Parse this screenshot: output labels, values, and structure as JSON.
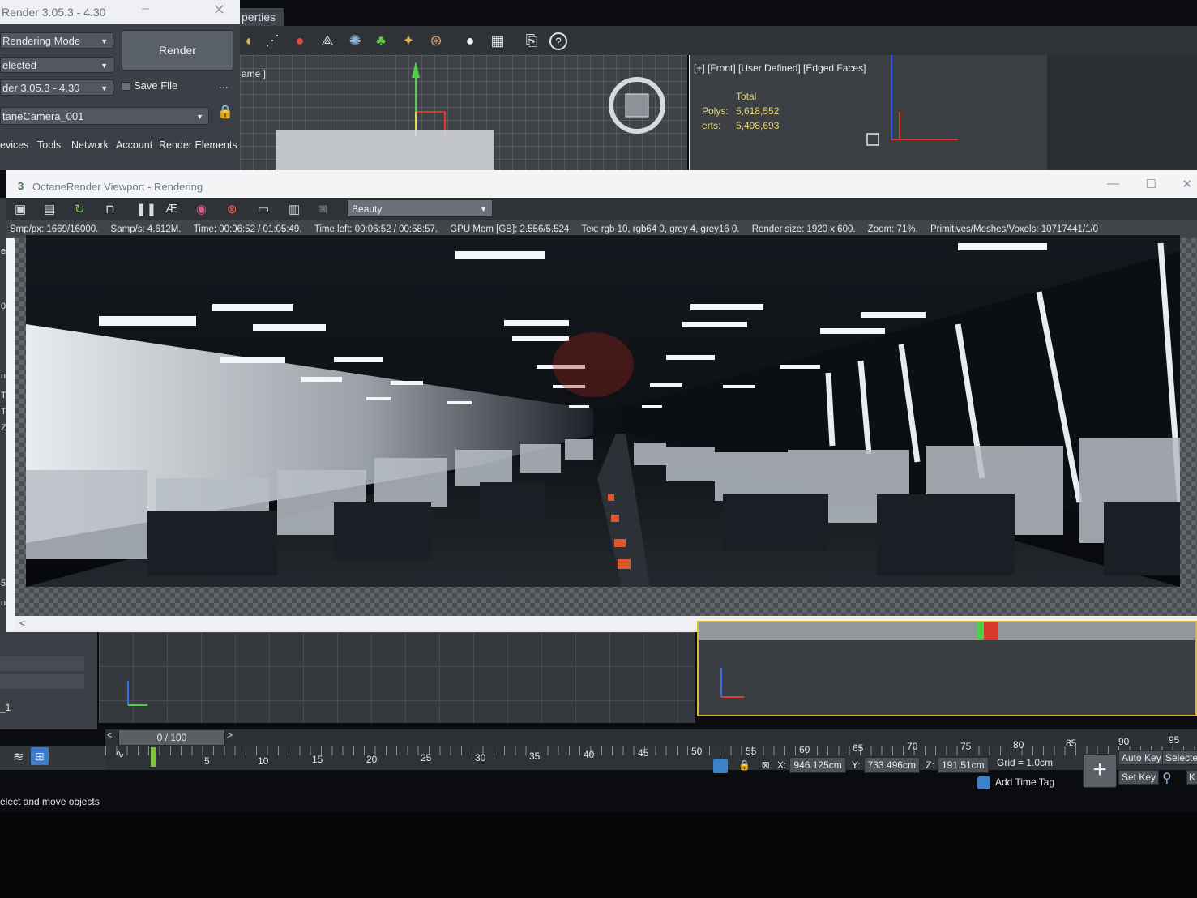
{
  "render_panel": {
    "title": "Render 3.05.3 - 4.30",
    "rendering_mode": "Rendering Mode",
    "selected": "elected",
    "renderer": "der 3.05.3 - 4.30",
    "render_button": "Render",
    "save_file": "Save File",
    "more": "...",
    "camera": "taneCamera_001",
    "tabs": [
      "evices",
      "Tools",
      "Network",
      "Account",
      "Render Elements"
    ]
  },
  "properties_tab": "perties",
  "viewport_left": {
    "label": "ame ]"
  },
  "viewport_right": {
    "label": "[+] [Front] [User Defined] [Edged Faces]",
    "stats_header": "Total",
    "polys_label": "Polys:",
    "polys_value": "5,618,552",
    "verts_label": "erts:",
    "verts_value": "5,498,693"
  },
  "octane": {
    "number": "3",
    "title": "OctaneRender Viewport - Rendering",
    "minimize": "—",
    "maximize": "☐",
    "close": "✕",
    "pass": "Beauty",
    "status": {
      "samples": "Smp/px: 1669/16000.",
      "speed": "Samp/s: 4.612M.",
      "time": "Time: 00:06:52 / 01:05:49.",
      "time_left": "Time left: 00:06:52 / 00:58:57.",
      "gpu_mem": "GPU Mem [GB]: 2.556/5.524",
      "tex": "Tex: rgb 10, rgb64 0, grey 4, grey16 0.",
      "render_size": "Render size: 1920 x 600.",
      "zoom": "Zoom: 71%.",
      "primitives": "Primitives/Meshes/Voxels: 10717441/1/0"
    },
    "scroll_left": "<"
  },
  "left_strip": [
    "er",
    "0",
    "n",
    "Ti",
    "Ti",
    "Zc",
    "5",
    "ne"
  ],
  "lower_panel_label": "_1",
  "timeline": {
    "position": "0 / 100",
    "prev": "<",
    "next": ">",
    "ticks": [
      "5",
      "10",
      "15",
      "20",
      "25",
      "30",
      "35",
      "40",
      "45",
      "50",
      "55",
      "60",
      "65",
      "70",
      "75",
      "80",
      "85",
      "90",
      "95"
    ]
  },
  "coords": {
    "x_label": "X:",
    "x_value": "946.125cm",
    "y_label": "Y:",
    "y_value": "733.496cm",
    "z_label": "Z:",
    "z_value": "191.51cm"
  },
  "grid": "Grid = 1.0cm",
  "add_time_tag": "Add Time Tag",
  "auto_key": "Auto Key",
  "set_key": "Set Key",
  "selected_btn": "Selecte",
  "k_btn": "K",
  "status_text": "elect and move objects",
  "colors": {
    "octane_green": "#3d7a54",
    "stats_yellow": "#e8d86a",
    "active_viewport": "#d9b83a"
  }
}
